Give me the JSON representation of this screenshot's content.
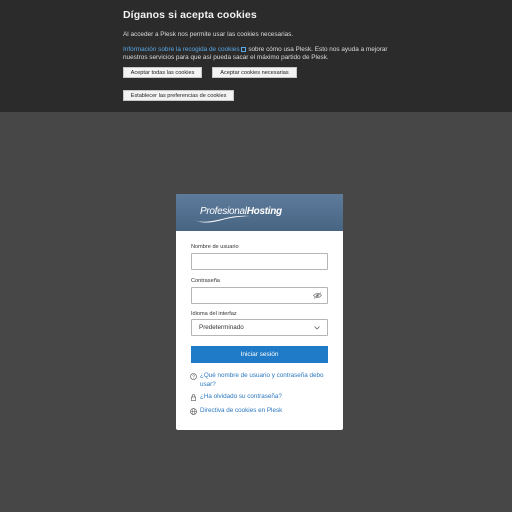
{
  "cookie_banner": {
    "title": "Díganos si acepta cookies",
    "line1": "Al acceder a Plesk nos permite usar las cookies necesarias.",
    "link_text": "Información sobre la recogida de cookies",
    "line2_after_link": "sobre cómo usa Plesk. Esto nos ayuda a mejorar",
    "line3": "nuestros servicios para que así pueda sacar el máximo partido de Plesk.",
    "accept_all_label": "Aceptar todas las cookies",
    "accept_necessary_label": "Aceptar cookies necesarias",
    "preferences_label": "Establecer las preferencias de cookies"
  },
  "login": {
    "logo_part1": "Profesional",
    "logo_part2": "Hosting",
    "username_label": "Nombre de usuario",
    "username_value": "",
    "password_label": "Contraseña",
    "password_value": "",
    "language_label": "Idioma del interfaz",
    "language_value": "Predeterminado",
    "login_button": "Iniciar sesión",
    "help_link1_line1": "¿Qué nombre de usuario y contraseña debo",
    "help_link1_line2": "usar?",
    "forgot_password": "¿Ha olvidado su contraseña?",
    "cookie_policy": "Directiva de cookies en Plesk"
  },
  "colors": {
    "page_bg": "#474747",
    "banner_bg": "#2b2b2b",
    "header_bg": "#4f6d8c",
    "primary_button": "#1f7ac7",
    "link": "#2a78c0"
  }
}
